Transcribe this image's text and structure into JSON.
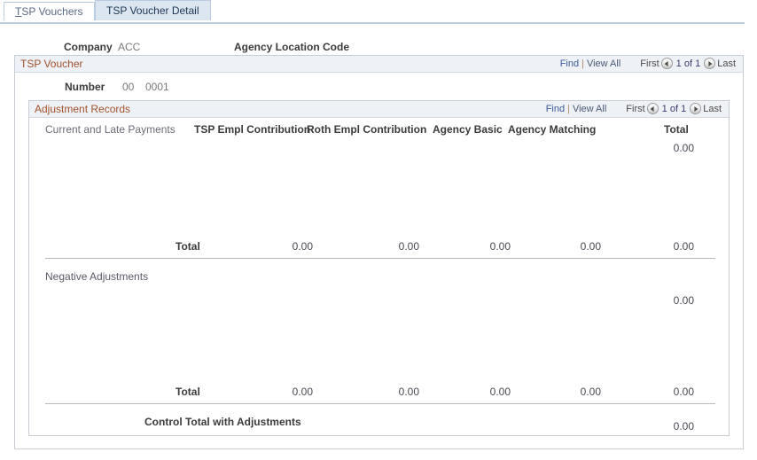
{
  "tabs": [
    {
      "accel": "T",
      "rest": "SP Vouchers",
      "label": "TSP Vouchers",
      "active": false
    },
    {
      "accel": "",
      "rest": "TSP Voucher Detail",
      "label": "TSP Voucher Detail",
      "active": true
    }
  ],
  "header": {
    "company_label": "Company",
    "company_value": "ACC",
    "agency_location_code_label": "Agency Location Code",
    "agency_location_code_value": ""
  },
  "tsp_voucher": {
    "title": "TSP Voucher",
    "nav": {
      "find": "Find",
      "separator": "|",
      "view_all": "View All",
      "first": "First",
      "counter": "1 of 1",
      "last": "Last",
      "prev_icon": "arrow-left-icon",
      "next_icon": "arrow-right-icon"
    },
    "number_label": "Number",
    "number_seq": "00",
    "number_value": "0001"
  },
  "adjustment_records": {
    "title": "Adjustment Records",
    "nav": {
      "find": "Find",
      "separator": "|",
      "view_all": "View All",
      "first": "First",
      "counter": "1 of 1",
      "last": "Last",
      "prev_icon": "arrow-left-icon",
      "next_icon": "arrow-right-icon"
    },
    "columns": [
      "Current and Late Payments",
      "TSP Empl Contribution",
      "Roth Empl Contribution",
      "Agency Basic",
      "Agency Matching",
      "Total"
    ],
    "current_section": {
      "total_display": "0.00",
      "total_label": "Total",
      "totals": [
        "0.00",
        "0.00",
        "0.00",
        "0.00",
        "0.00"
      ]
    },
    "negative_section": {
      "label": "Negative Adjustments",
      "total_display": "0.00",
      "total_label": "Total",
      "totals": [
        "0.00",
        "0.00",
        "0.00",
        "0.00",
        "0.00"
      ]
    },
    "control_total": {
      "label": "Control Total with Adjustments",
      "value": "0.00"
    }
  },
  "colors": {
    "group_title": "#a0522d",
    "link": "#3b5998",
    "tab_active_bg": "#dce6f1",
    "tab_border": "#b9cbe0"
  }
}
